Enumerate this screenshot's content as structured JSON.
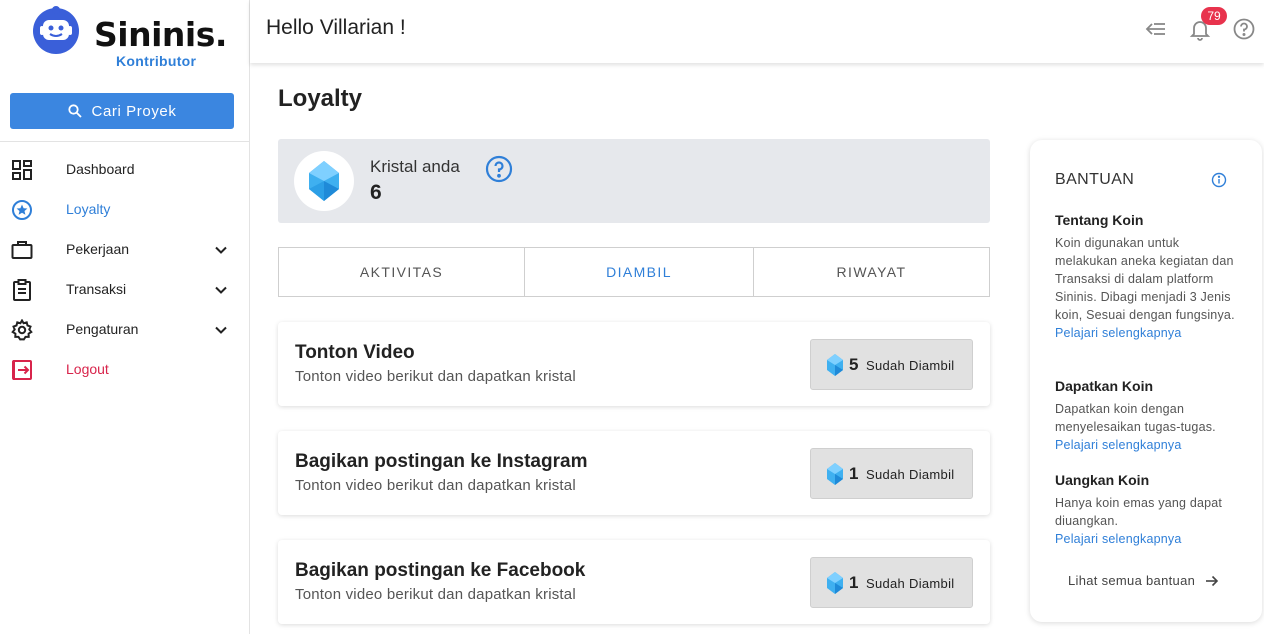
{
  "brand": {
    "name": "Sininis.",
    "subtitle": "Kontributor"
  },
  "sidebar": {
    "search_label": "Cari Proyek",
    "items": [
      {
        "label": "Dashboard",
        "icon": "dashboard-icon"
      },
      {
        "label": "Loyalty",
        "icon": "star-icon",
        "active": true
      },
      {
        "label": "Pekerjaan",
        "icon": "briefcase-icon",
        "expandable": true
      },
      {
        "label": "Transaksi",
        "icon": "clipboard-icon",
        "expandable": true
      },
      {
        "label": "Pengaturan",
        "icon": "gear-icon",
        "expandable": true
      },
      {
        "label": "Logout",
        "icon": "logout-icon"
      }
    ]
  },
  "header": {
    "greeting": "Hello Villarian !",
    "notification_count": "79"
  },
  "main": {
    "title": "Loyalty",
    "crystal": {
      "label": "Kristal anda",
      "value": "6"
    },
    "tabs": [
      {
        "label": "AKTIVITAS"
      },
      {
        "label": "DIAMBIL",
        "active": true
      },
      {
        "label": "RIWAYAT"
      }
    ],
    "tasks": [
      {
        "title": "Tonton Video",
        "desc": "Tonton video berikut dan dapatkan kristal",
        "reward": "5",
        "status": "Sudah Diambil"
      },
      {
        "title": "Bagikan postingan ke Instagram",
        "desc": "Tonton video berikut dan dapatkan kristal",
        "reward": "1",
        "status": "Sudah Diambil"
      },
      {
        "title": "Bagikan postingan ke Facebook",
        "desc": "Tonton video berikut dan dapatkan kristal",
        "reward": "1",
        "status": "Sudah Diambil"
      }
    ]
  },
  "help": {
    "title": "BANTUAN",
    "sections": [
      {
        "title": "Tentang Koin",
        "text": "Koin digunakan untuk melakukan aneka kegiatan dan Transaksi di dalam platform Sininis. Dibagi menjadi 3 Jenis koin, Sesuai dengan fungsinya.",
        "link": "Pelajari selengkapnya"
      },
      {
        "title": "Dapatkan Koin",
        "text": "Dapatkan koin dengan menyelesaikan tugas-tugas.",
        "link": "Pelajari selengkapnya"
      },
      {
        "title": "Uangkan Koin",
        "text": "Hanya koin emas yang dapat diuangkan.",
        "link": "Pelajari selengkapnya"
      }
    ],
    "see_all": "Lihat semua bantuan"
  },
  "colors": {
    "accent": "#3b86e0",
    "link": "#2f7fd8",
    "logout": "#d8244b",
    "badge": "#e8334d",
    "crystal": "#3fb0f0"
  }
}
